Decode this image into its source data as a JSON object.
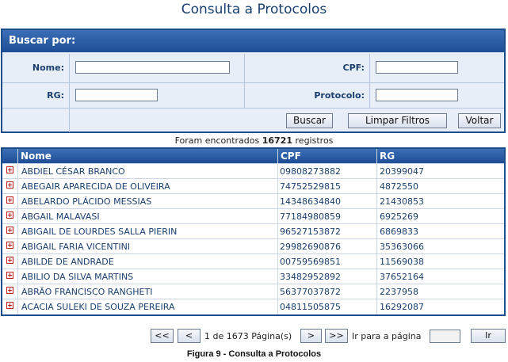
{
  "page_title": "Consulta a Protocolos",
  "search": {
    "header": "Buscar por:",
    "nome_label": "Nome:",
    "nome_value": "",
    "cpf_label": "CPF:",
    "cpf_value": "",
    "rg_label": "RG:",
    "rg_value": "",
    "protocolo_label": "Protocolo:",
    "protocolo_value": "",
    "buscar_button": "Buscar",
    "limpar_button": "Limpar Filtros",
    "voltar_button": "Voltar"
  },
  "results": {
    "prefix": "Foram encontrados",
    "count": "16721",
    "suffix": "registros"
  },
  "table": {
    "columns": [
      "Nome",
      "CPF",
      "RG"
    ],
    "rows": [
      {
        "nome": "ABDIEL CÉSAR BRANCO",
        "cpf": "09808273882",
        "rg": "20399047"
      },
      {
        "nome": "ABEGAIR APARECIDA DE OLIVEIRA",
        "cpf": "74752529815",
        "rg": "4872550"
      },
      {
        "nome": "ABELARDO PLÁCIDO MESSIAS",
        "cpf": "14348634840",
        "rg": "21430853"
      },
      {
        "nome": "ABGAIL MALAVASI",
        "cpf": "77184980859",
        "rg": "6925269"
      },
      {
        "nome": "ABIGAIL DE LOURDES SALLA PIERIN",
        "cpf": "96527153872",
        "rg": "6869833"
      },
      {
        "nome": "ABIGAIL FARIA VICENTINI",
        "cpf": "29982690876",
        "rg": "35363066"
      },
      {
        "nome": "ABILDE DE ANDRADE",
        "cpf": "00759569851",
        "rg": "11569038"
      },
      {
        "nome": "ABILIO DA SILVA MARTINS",
        "cpf": "33482952892",
        "rg": "37652164"
      },
      {
        "nome": "ABRÃO FRANCISCO RANGHETI",
        "cpf": "56377037872",
        "rg": "2237958"
      },
      {
        "nome": "ACACIA SULEKI DE SOUZA PEREIRA",
        "cpf": "04811505875",
        "rg": "16292087"
      }
    ]
  },
  "pager": {
    "first": "<<",
    "prev": "<",
    "status": "1 de 1673 Página(s)",
    "next": ">",
    "last": ">>",
    "goto_label": "Ir para a página",
    "goto_value": "",
    "go_button": "Ir"
  },
  "caption": "Figura 9 - Consulta a Protocolos",
  "colors": {
    "header_blue": "#1d4e95",
    "panel_bg": "#e8eef8",
    "text_blue": "#1a3f6e",
    "expand_red": "#c41d1d"
  }
}
